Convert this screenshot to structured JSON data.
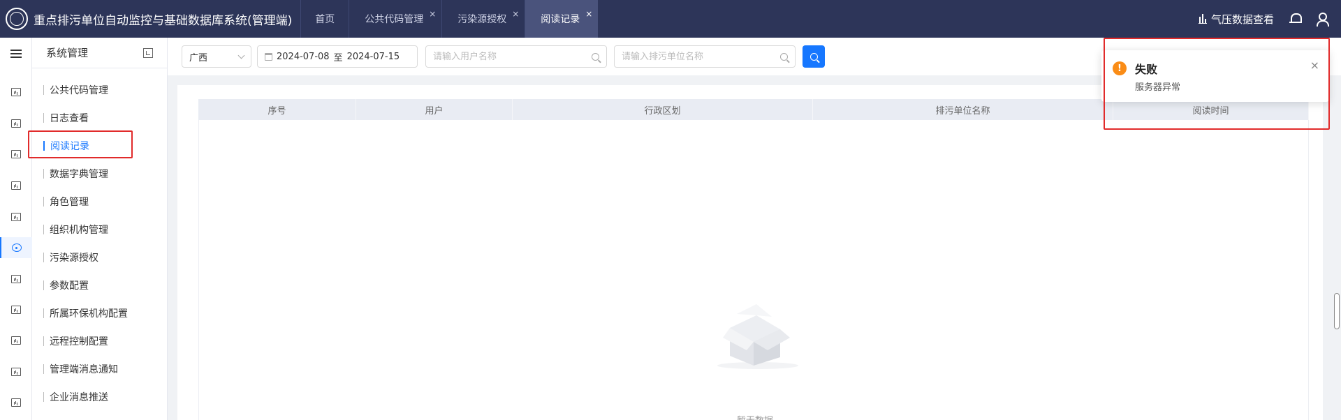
{
  "header": {
    "app_title": "重点排污单位自动监控与基础数据库系统(管理端)",
    "tabs": [
      {
        "label": "首页"
      },
      {
        "label": "公共代码管理"
      },
      {
        "label": "污染源授权"
      },
      {
        "label": "阅读记录"
      }
    ],
    "close_glyph": "×",
    "pressure_label": "气压数据查看"
  },
  "subsidebar": {
    "title": "系统管理",
    "items": [
      {
        "label": "公共代码管理"
      },
      {
        "label": "日志查看"
      },
      {
        "label": "阅读记录"
      },
      {
        "label": "数据字典管理"
      },
      {
        "label": "角色管理"
      },
      {
        "label": "组织机构管理"
      },
      {
        "label": "污染源授权"
      },
      {
        "label": "参数配置"
      },
      {
        "label": "所属环保机构配置"
      },
      {
        "label": "远程控制配置"
      },
      {
        "label": "管理端消息通知"
      },
      {
        "label": "企业消息推送"
      }
    ],
    "active_index": 2
  },
  "filters": {
    "region_value": "广西",
    "date_start": "2024-07-08",
    "date_sep": "至",
    "date_end": "2024-07-15",
    "user_placeholder": "请输入用户名称",
    "unit_placeholder": "请输入排污单位名称"
  },
  "table": {
    "columns": [
      "序号",
      "用户",
      "行政区划",
      "排污单位名称",
      "阅读时间"
    ],
    "empty_text": "暂无数据"
  },
  "notification": {
    "title": "失败",
    "message": "服务器异常",
    "icon": "!",
    "close_glyph": "×"
  },
  "colors": {
    "topbar": "#2d3559",
    "accent": "#1677ff",
    "warning": "#fa8c16",
    "highlight": "#e12b2b"
  }
}
